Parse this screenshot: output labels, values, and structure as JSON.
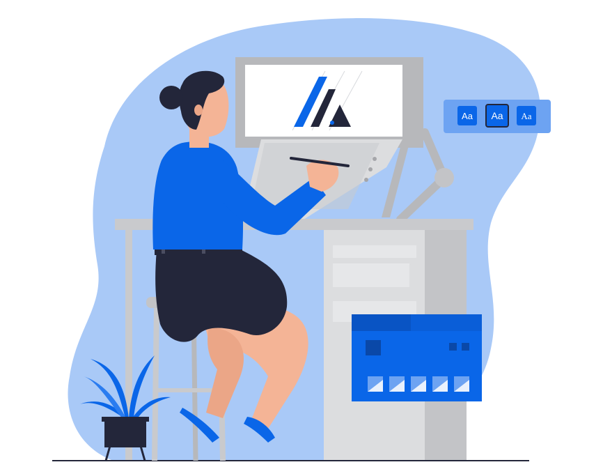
{
  "font_chips": [
    {
      "label": "Aa"
    },
    {
      "label": "Aa"
    },
    {
      "label": "Aa"
    }
  ],
  "colors": {
    "blob": "#a9c9f7",
    "accent_blue": "#0a66e8",
    "dark_navy": "#23263a",
    "skin": "#f4b496",
    "desk_gray": "#c9cacd",
    "desk_light": "#dcdddf",
    "monitor_frame": "#b7b8bb"
  },
  "icons": [
    "plant-icon",
    "logo-icon",
    "type-style-panel-icon",
    "window-panel-icon"
  ]
}
